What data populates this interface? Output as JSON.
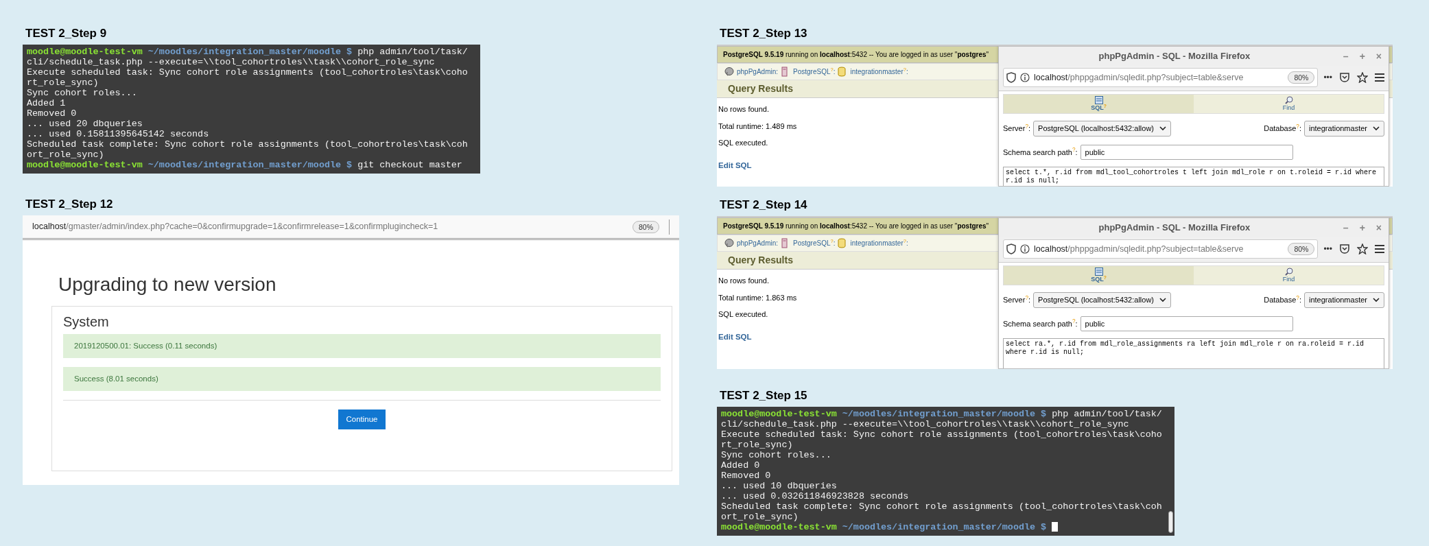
{
  "left_column": [
    {
      "kind": "terminal",
      "label": "TEST 2_Step 9",
      "lines": [
        {
          "kind": "prompt",
          "user": "moodle@moodle-test-vm",
          "path": "~/moodles/integration_master/moodle $",
          "command": "php admin/tool/task/cli/schedule_task.php --execute=\\\\tool_cohortroles\\\\task\\\\cohort_role_sync"
        },
        {
          "kind": "output",
          "text": "Execute scheduled task: Sync cohort role assignments (tool_cohortroles\\task\\cohort_role_sync)"
        },
        {
          "kind": "output",
          "text": "Sync cohort roles..."
        },
        {
          "kind": "output",
          "text": "Added 1"
        },
        {
          "kind": "output",
          "text": "Removed 0"
        },
        {
          "kind": "output",
          "text": "... used 20 dbqueries"
        },
        {
          "kind": "output",
          "text": "... used 0.15811395645142 seconds"
        },
        {
          "kind": "output",
          "text": "Scheduled task complete: Sync cohort role assignments (tool_cohortroles\\task\\cohort_role_sync)"
        },
        {
          "kind": "prompt",
          "user": "moodle@moodle-test-vm",
          "path": "~/moodles/integration_master/moodle $",
          "command": "git checkout master"
        }
      ]
    },
    {
      "kind": "upgrade",
      "label": "TEST 2_Step 12",
      "url_host": "localhost",
      "url_path": "/gmaster/admin/index.php?cache=0&confirmupgrade=1&confirmrelease=1&confirmplugincheck=1",
      "zoom": "80%",
      "heading": "Upgrading to new version",
      "section": "System",
      "notices": [
        "2019120500.01: Success (0.11 seconds)",
        "Success (8.01 seconds)"
      ],
      "button": "Continue"
    }
  ],
  "right_column": [
    {
      "kind": "pgadmin",
      "label": "TEST 2_Step 13",
      "server_info": "**PostgreSQL 9.5.19** running on **localhost**:5432 -- You are logged in as user \"**postgres**\"",
      "breadcrumbs": [
        "phpPgAdmin:",
        "PostgreSQL$^{?}$:",
        "integrationmaster$^{?}$:"
      ],
      "results_title": "Query Results",
      "messages": [
        "No rows found.",
        "Total runtime: 1.489 ms",
        "SQL executed."
      ],
      "edit_link": "Edit SQL",
      "popup": {
        "title": "phpPgAdmin - SQL - Mozilla Firefox",
        "window_controls": [
          "–",
          "+",
          "×"
        ],
        "url_host": "localhost",
        "url_path": "/phppgadmin/sqledit.php?subject=table&serve",
        "zoom": "80%",
        "more": "•••",
        "tabs": [
          {
            "label": "SQL$^{?}$",
            "selected": true
          },
          {
            "label": "Find",
            "selected": false
          }
        ],
        "server_label": "Server$^{?}$:",
        "server": "PostgreSQL (localhost:5432:allow)",
        "database_label": "Database$^{?}$:",
        "database": "integrationmaster",
        "schema_label": "Schema search path$^{?}$:",
        "schema": "public",
        "query": "select t.*, r.id from mdl_tool_cohortroles t left join mdl_role r on t.roleid = r.id where r.id is null;"
      }
    },
    {
      "kind": "pgadmin",
      "label": "TEST 2_Step 14",
      "server_info": "**PostgreSQL 9.5.19** running on **localhost**:5432 -- You are logged in as user \"**postgres**\"",
      "breadcrumbs": [
        "phpPgAdmin:",
        "PostgreSQL$^{?}$:",
        "integrationmaster$^{?}$:"
      ],
      "results_title": "Query Results",
      "messages": [
        "No rows found.",
        "Total runtime: 1.863 ms",
        "SQL executed."
      ],
      "edit_link": "Edit SQL",
      "popup": {
        "title": "phpPgAdmin - SQL - Mozilla Firefox",
        "window_controls": [
          "–",
          "+",
          "×"
        ],
        "url_host": "localhost",
        "url_path": "/phppgadmin/sqledit.php?subject=table&serve",
        "zoom": "80%",
        "more": "•••",
        "tabs": [
          {
            "label": "SQL$^{?}$",
            "selected": true
          },
          {
            "label": "Find",
            "selected": false
          }
        ],
        "server_label": "Server$^{?}$:",
        "server": "PostgreSQL (localhost:5432:allow)",
        "database_label": "Database$^{?}$:",
        "database": "integrationmaster",
        "schema_label": "Schema search path$^{?}$:",
        "schema": "public",
        "query": "select ra.*, r.id from mdl_role_assignments ra left join mdl_role r on ra.roleid = r.id\nwhere r.id is null;"
      }
    },
    {
      "kind": "terminal",
      "label": "TEST 2_Step 15",
      "cursor": true,
      "lines": [
        {
          "kind": "prompt",
          "user": "moodle@moodle-test-vm",
          "path": "~/moodles/integration_master/moodle $",
          "command": "php admin/tool/task/cli/schedule_task.php --execute=\\\\tool_cohortroles\\\\task\\\\cohort_role_sync"
        },
        {
          "kind": "output",
          "text": "Execute scheduled task: Sync cohort role assignments (tool_cohortroles\\task\\cohort_role_sync)"
        },
        {
          "kind": "output",
          "text": "Sync cohort roles..."
        },
        {
          "kind": "output",
          "text": "Added 0"
        },
        {
          "kind": "output",
          "text": "Removed 0"
        },
        {
          "kind": "output",
          "text": "... used 10 dbqueries"
        },
        {
          "kind": "output",
          "text": "... used 0.032611846923828 seconds"
        },
        {
          "kind": "output",
          "text": "Scheduled task complete: Sync cohort role assignments (tool_cohortroles\\task\\cohort_role_sync)"
        },
        {
          "kind": "prompt",
          "user": "moodle@moodle-test-vm",
          "path": "~/moodles/integration_master/moodle $"
        }
      ]
    }
  ]
}
